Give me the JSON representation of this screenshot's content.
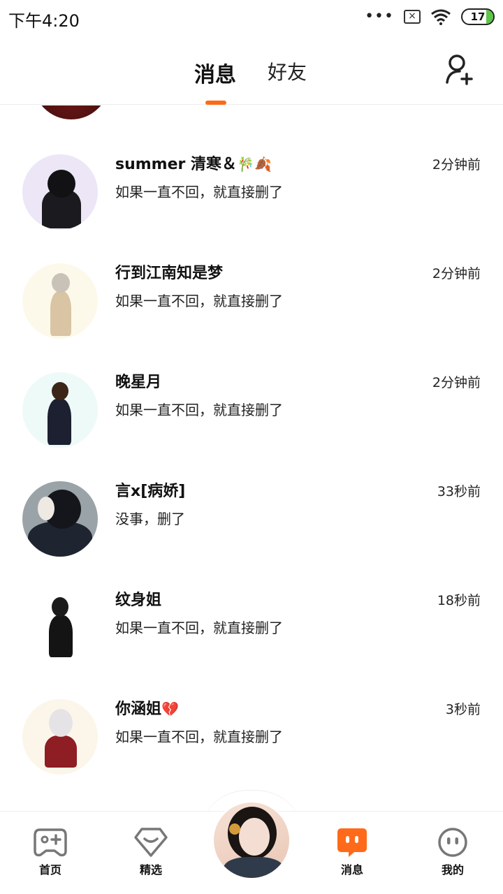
{
  "status_bar": {
    "time": "下午4:20",
    "battery": "17"
  },
  "tabs": {
    "messages": "消息",
    "friends": "好友"
  },
  "conversations": [
    {
      "name": "summer 清寒＆",
      "emoji": "🎋🍂",
      "message": "如果一直不回，就直接删了",
      "time": "2分钟前"
    },
    {
      "name": "行到江南知是梦",
      "emoji": "",
      "message": "如果一直不回，就直接删了",
      "time": "2分钟前"
    },
    {
      "name": "晚星月",
      "emoji": "",
      "message": "如果一直不回，就直接删了",
      "time": "2分钟前"
    },
    {
      "name": "言x[病娇]",
      "emoji": "",
      "message": "没事，删了",
      "time": "33秒前"
    },
    {
      "name": "纹身姐",
      "emoji": "",
      "message": "如果一直不回，就直接删了",
      "time": "18秒前"
    },
    {
      "name": "你涵姐",
      "emoji": "💔",
      "message": "如果一直不回，就直接删了",
      "time": "3秒前"
    }
  ],
  "bottom_nav": {
    "home": "首页",
    "featured": "精选",
    "messages": "消息",
    "me": "我的"
  },
  "colors": {
    "accent": "#ff6a1a",
    "battery_green": "#5ec44b"
  },
  "icons": {
    "add_friend": "add-friend-icon",
    "home": "gamepad-icon",
    "featured": "heart-badge-icon",
    "messages": "chat-bubble-icon",
    "me": "face-icon"
  }
}
